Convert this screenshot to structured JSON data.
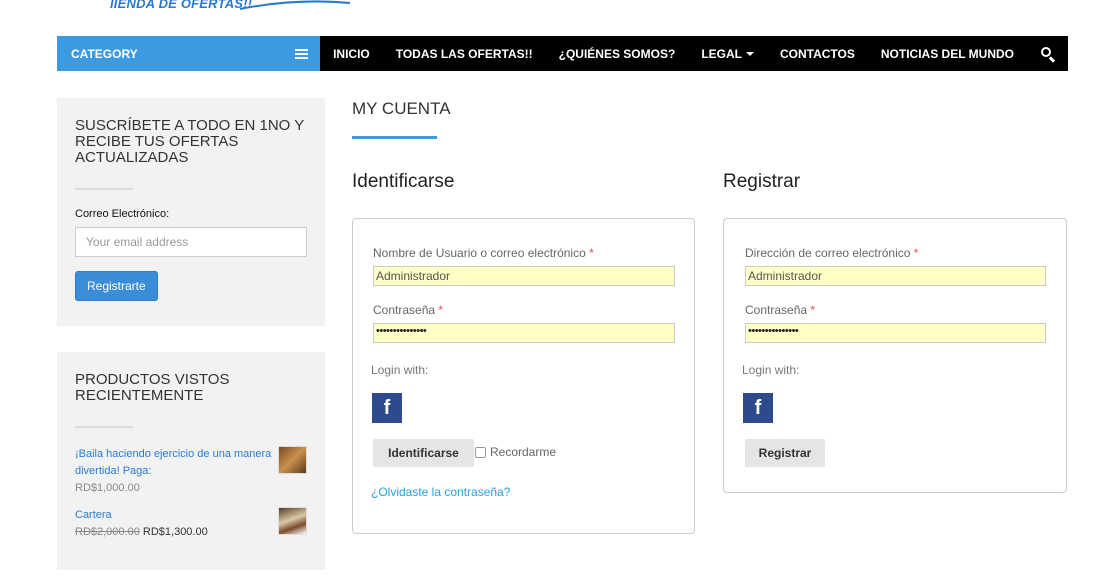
{
  "header": {
    "logo_text": "IIENDA DE OFERTAS!!"
  },
  "nav": {
    "category_label": "CATEGORY",
    "items": [
      "INICIO",
      "TODAS LAS OFERTAS!!",
      "¿QUIÉNES SOMOS?",
      "LEGAL",
      "CONTACTOS",
      "NOTICIAS DEL MUNDO"
    ]
  },
  "sidebar": {
    "subscribe": {
      "title": "SUSCRÍBETE A TODO EN 1NO Y RECIBE TUS OFERTAS ACTUALIZADAS",
      "email_label": "Correo Electrónico:",
      "email_placeholder": "Your email address",
      "button_label": "Registrarte"
    },
    "recent": {
      "title": "PRODUCTOS VISTOS RECIENTEMENTE",
      "products": [
        {
          "name": "¡Baila haciendo ejercicio de una manera divertida! Paga:",
          "price": "RD$1,000.00"
        },
        {
          "name": "Cartera",
          "old_price": "RD$2,000.00",
          "price": "RD$1,300.00"
        }
      ]
    }
  },
  "main": {
    "title": "MY CUENTA",
    "login": {
      "heading": "Identificarse",
      "user_label": "Nombre de Usuario o correo electrónico",
      "user_value": "Administrador",
      "pass_label": "Contraseña",
      "pass_value": "•••••••••••••••",
      "login_with": "Login with:",
      "fb_icon": "f",
      "button_label": "Identificarse",
      "remember_label": "Recordarme",
      "forgot_link": "¿Olvidaste la contraseña?"
    },
    "register": {
      "heading": "Registrar",
      "email_label": "Dirección de correo electrónico",
      "email_value": "Administrador",
      "pass_label": "Contraseña",
      "pass_value": "•••••••••••••••",
      "login_with": "Login with:",
      "fb_icon": "f",
      "button_label": "Registrar"
    },
    "required_mark": "*"
  },
  "colors": {
    "accent": "#3b9ae0",
    "nav_bg": "#000000",
    "facebook": "#2c4a8c",
    "autofill": "#ffffc6"
  }
}
